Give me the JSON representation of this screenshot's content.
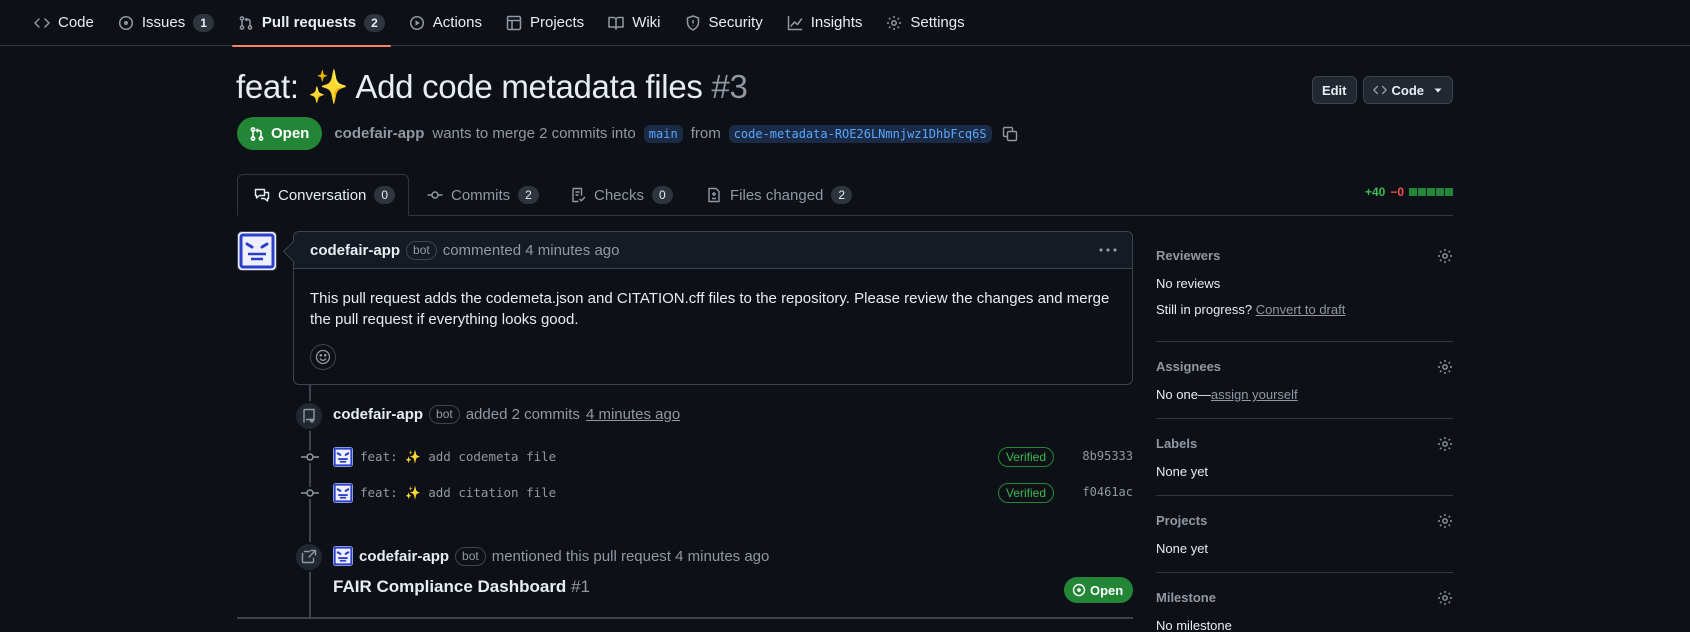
{
  "nav": {
    "items": [
      {
        "label": "Code",
        "icon": "code-icon"
      },
      {
        "label": "Issues",
        "count": "1",
        "icon": "issue-opened-icon"
      },
      {
        "label": "Pull requests",
        "count": "2",
        "icon": "git-pull-request-icon",
        "active": true
      },
      {
        "label": "Actions",
        "icon": "play-icon"
      },
      {
        "label": "Projects",
        "icon": "table-icon"
      },
      {
        "label": "Wiki",
        "icon": "book-icon"
      },
      {
        "label": "Security",
        "icon": "shield-icon"
      },
      {
        "label": "Insights",
        "icon": "graph-icon"
      },
      {
        "label": "Settings",
        "icon": "gear-icon"
      }
    ]
  },
  "pr": {
    "title": "feat: ✨ Add code metadata files",
    "number": "#3",
    "edit_label": "Edit",
    "code_label": "Code",
    "state": "Open",
    "author": "codefair-app",
    "merge_text": "wants to merge 2 commits into",
    "base_branch": "main",
    "from_text": "from",
    "head_branch": "code-metadata-ROE26LNmnjwz1DhbFcq6S"
  },
  "tabs": [
    {
      "label": "Conversation",
      "count": "0",
      "icon": "comment-discussion-icon"
    },
    {
      "label": "Commits",
      "count": "2",
      "icon": "git-commit-icon"
    },
    {
      "label": "Checks",
      "count": "0",
      "icon": "checklist-icon"
    },
    {
      "label": "Files changed",
      "count": "2",
      "icon": "file-diff-icon"
    }
  ],
  "diffstat": {
    "additions": "+40",
    "deletions": "−0",
    "blocks": 5
  },
  "comment": {
    "author": "codefair-app",
    "badge": "bot",
    "action": "commented 4 minutes ago",
    "body": "This pull request adds the codemeta.json and CITATION.cff files to the repository. Please review the changes and merge the pull request if everything looks good."
  },
  "timeline": {
    "commits_event": {
      "author": "codefair-app",
      "badge": "bot",
      "action": "added 2 commits",
      "time": "4 minutes ago"
    },
    "commits": [
      {
        "message": "feat: ✨ add codemeta file",
        "verified": "Verified",
        "sha": "8b95333"
      },
      {
        "message": "feat: ✨ add citation file",
        "verified": "Verified",
        "sha": "f0461ac"
      }
    ],
    "mention_event": {
      "author": "codefair-app",
      "badge": "bot",
      "action": "mentioned this pull request 4 minutes ago",
      "ref_title": "FAIR Compliance Dashboard",
      "ref_number": "#1",
      "ref_state": "Open"
    }
  },
  "sidebar": {
    "reviewers": {
      "heading": "Reviewers",
      "value": "No reviews",
      "progress_text": "Still in progress?",
      "progress_link": "Convert to draft"
    },
    "assignees": {
      "heading": "Assignees",
      "value": "No one—",
      "link": "assign yourself"
    },
    "labels": {
      "heading": "Labels",
      "value": "None yet"
    },
    "projects": {
      "heading": "Projects",
      "value": "None yet"
    },
    "milestone": {
      "heading": "Milestone",
      "value": "No milestone"
    }
  },
  "colors": {
    "accent_open": "#238636",
    "link": "#58a6ff",
    "nav_underline": "#f78166",
    "avatar": "#2b3fc9"
  }
}
